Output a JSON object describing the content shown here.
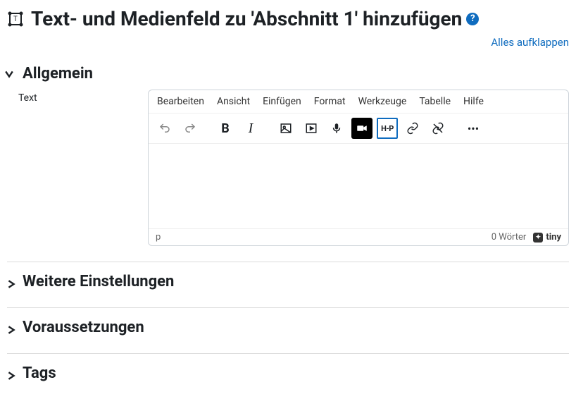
{
  "page": {
    "title": "Text- und Medienfeld zu 'Abschnitt 1' hinzufügen",
    "expand_all": "Alles aufklappen"
  },
  "sections": {
    "general": {
      "title": "Allgemein",
      "expanded": true
    },
    "further": {
      "title": "Weitere Einstellungen",
      "expanded": false
    },
    "prereq": {
      "title": "Voraussetzungen",
      "expanded": false
    },
    "tags": {
      "title": "Tags",
      "expanded": false
    }
  },
  "field": {
    "label": "Text"
  },
  "editor": {
    "menubar": {
      "edit": "Bearbeiten",
      "view": "Ansicht",
      "insert": "Einfügen",
      "format": "Format",
      "tools": "Werkzeuge",
      "table": "Tabelle",
      "help": "Hilfe"
    },
    "toolbar": {
      "bold": "B",
      "italic": "I",
      "h5p": "H-P",
      "more": "•••"
    },
    "status": {
      "path": "p",
      "words": "0 Wörter",
      "branding": "tiny"
    }
  }
}
